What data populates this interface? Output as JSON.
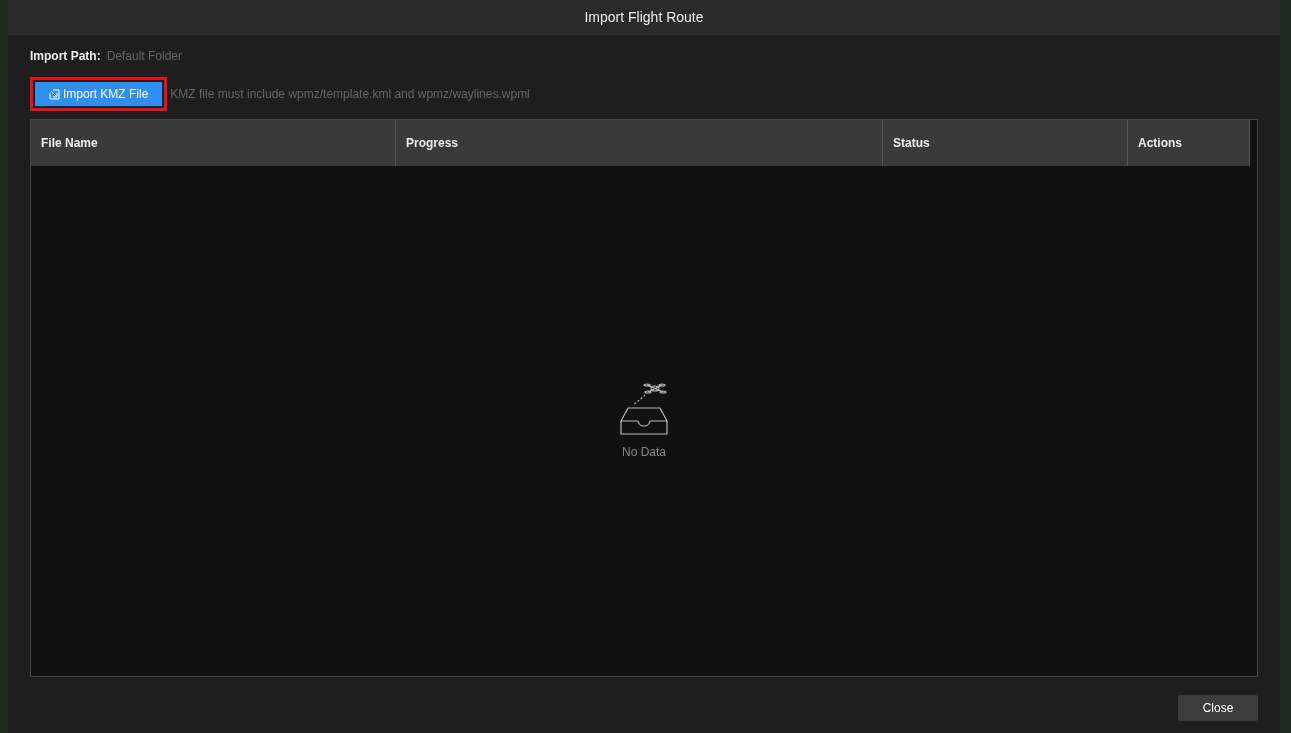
{
  "window": {
    "title": "Import Flight Route"
  },
  "import_path": {
    "label": "Import Path:",
    "value": "Default Folder"
  },
  "import_button": {
    "label": "Import KMZ File"
  },
  "hint": "KMZ file must include wpmz/template.kml and wpmz/waylines.wpml",
  "table": {
    "columns": [
      "File Name",
      "Progress",
      "Status",
      "Actions"
    ],
    "empty_text": "No Data"
  },
  "buttons": [
    "Close"
  ]
}
